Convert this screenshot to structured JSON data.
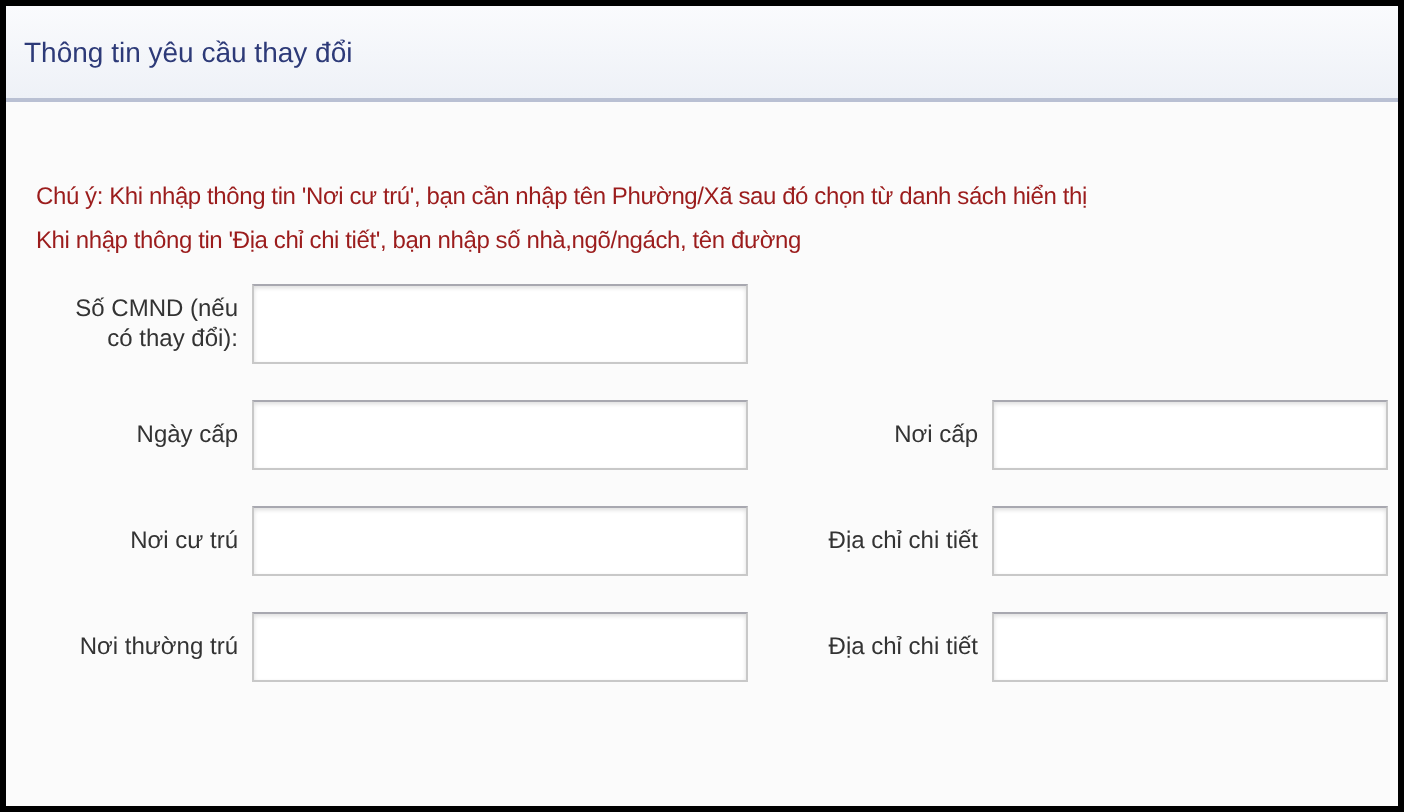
{
  "panel": {
    "title": "Thông tin yêu cầu thay đổi"
  },
  "notes": [
    "Chú ý: Khi nhập thông tin 'Nơi cư trú', bạn cần nhập tên Phường/Xã sau đó chọn từ danh sách hiển thị",
    "Khi nhập thông tin 'Địa chỉ chi tiết', bạn nhập số nhà,ngõ/ngách, tên đường"
  ],
  "rows": [
    {
      "fields": [
        {
          "label": "Số CMND (nếu có thay đổi):"
        }
      ]
    },
    {
      "fields": [
        {
          "label": "Ngày cấp"
        },
        {
          "label": "Nơi cấp"
        }
      ]
    },
    {
      "fields": [
        {
          "label": "Nơi cư trú"
        },
        {
          "label": "Địa chỉ chi tiết"
        }
      ]
    },
    {
      "fields": [
        {
          "label": "Nơi thường trú"
        },
        {
          "label": "Địa chỉ chi tiết"
        }
      ]
    }
  ]
}
